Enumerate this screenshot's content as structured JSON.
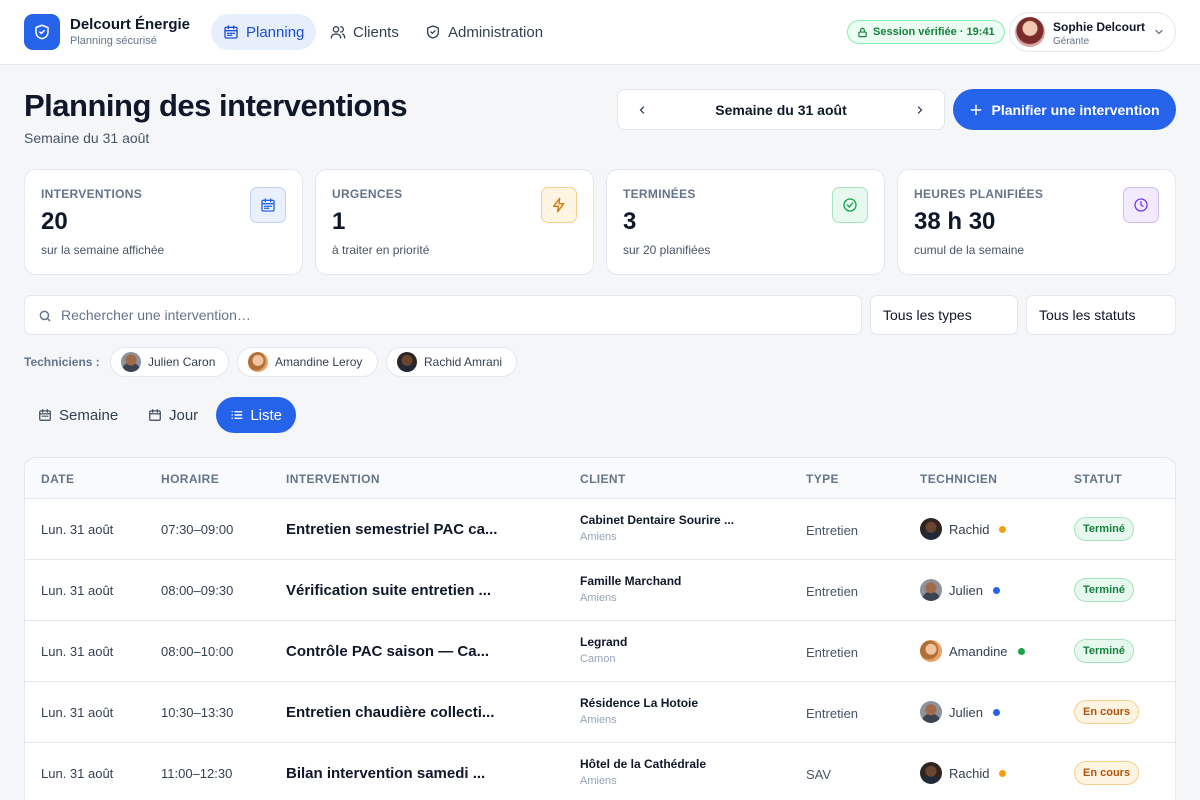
{
  "brand": {
    "name": "Delcourt Énergie",
    "subtitle": "Planning sécurisé"
  },
  "nav": [
    {
      "label": "Planning",
      "icon": "calendar-icon",
      "active": true
    },
    {
      "label": "Clients",
      "icon": "users-icon",
      "active": false
    },
    {
      "label": "Administration",
      "icon": "shield-icon",
      "active": false
    }
  ],
  "session": {
    "label": "Session vérifiée · 19:41"
  },
  "user": {
    "name": "Sophie Delcourt",
    "role": "Gérante"
  },
  "page": {
    "title": "Planning des interventions",
    "subtitle": "Semaine du 31 août"
  },
  "week_picker": {
    "label": "Semaine du 31 août"
  },
  "actions": {
    "plan_label": "Planifier une intervention"
  },
  "stats": [
    {
      "label": "INTERVENTIONS",
      "value": "20",
      "sub": "sur la semaine affichée",
      "icon": "calendar-icon",
      "color": "#2563eb"
    },
    {
      "label": "URGENCES",
      "value": "1",
      "sub": "à traiter en priorité",
      "icon": "bolt-icon",
      "color": "#d97706"
    },
    {
      "label": "TERMINÉES",
      "value": "3",
      "sub": "sur 20 planifiées",
      "icon": "check-circle-icon",
      "color": "#16a34a"
    },
    {
      "label": "HEURES PLANIFIÉES",
      "value": "38 h 30",
      "sub": "cumul de la semaine",
      "icon": "clock-icon",
      "color": "#7c3aed"
    }
  ],
  "filters": {
    "search_placeholder": "Rechercher une intervention…",
    "type_select": "Tous les types",
    "status_select": "Tous les statuts"
  },
  "technicians": {
    "label": "Techniciens :",
    "items": [
      "Julien Caron",
      "Amandine Leroy",
      "Rachid Amrani"
    ]
  },
  "views": [
    {
      "label": "Semaine",
      "icon": "calendar-icon",
      "active": false
    },
    {
      "label": "Jour",
      "icon": "calendar-day-icon",
      "active": false
    },
    {
      "label": "Liste",
      "icon": "list-icon",
      "active": true
    }
  ],
  "table": {
    "headers": [
      "DATE",
      "HORAIRE",
      "INTERVENTION",
      "CLIENT",
      "TYPE",
      "TECHNICIEN",
      "STATUT"
    ],
    "rows": [
      {
        "date": "Lun. 31 août",
        "time": "07:30–09:00",
        "title": "Entretien semestriel PAC ca...",
        "client": "Cabinet Dentaire Sourire ...",
        "city": "Amiens",
        "type": "Entretien",
        "tech": "Rachid",
        "tech_color": "#f59e0b",
        "status": "Terminé",
        "status_kind": "done"
      },
      {
        "date": "Lun. 31 août",
        "time": "08:00–09:30",
        "title": "Vérification suite entretien ...",
        "client": "Famille Marchand",
        "city": "Amiens",
        "type": "Entretien",
        "tech": "Julien",
        "tech_color": "#2563eb",
        "status": "Terminé",
        "status_kind": "done"
      },
      {
        "date": "Lun. 31 août",
        "time": "08:00–10:00",
        "title": "Contrôle PAC saison — Ca...",
        "client": "Legrand",
        "city": "Camon",
        "type": "Entretien",
        "tech": "Amandine",
        "tech_color": "#16a34a",
        "status": "Terminé",
        "status_kind": "done"
      },
      {
        "date": "Lun. 31 août",
        "time": "10:30–13:30",
        "title": "Entretien chaudière collecti...",
        "client": "Résidence La Hotoie",
        "city": "Amiens",
        "type": "Entretien",
        "tech": "Julien",
        "tech_color": "#2563eb",
        "status": "En cours",
        "status_kind": "progress"
      },
      {
        "date": "Lun. 31 août",
        "time": "11:00–12:30",
        "title": "Bilan intervention samedi ...",
        "client": "Hôtel de la Cathédrale",
        "city": "Amiens",
        "type": "SAV",
        "tech": "Rachid",
        "tech_color": "#f59e0b",
        "status": "En cours",
        "status_kind": "progress"
      }
    ]
  }
}
